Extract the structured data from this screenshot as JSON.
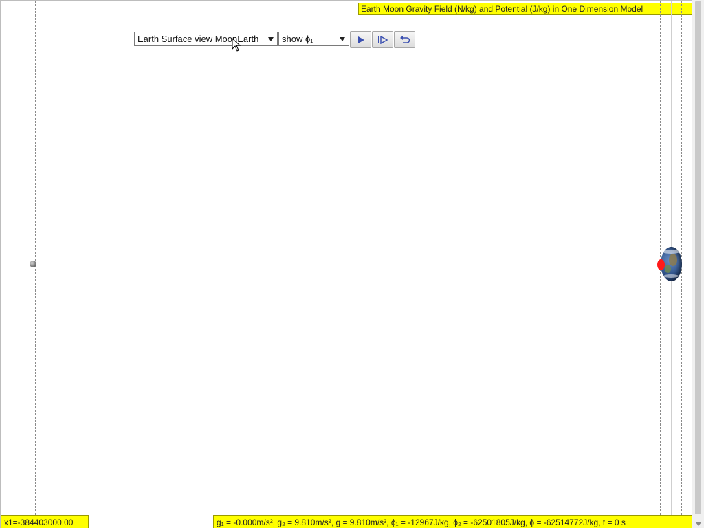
{
  "title": "Earth Moon Gravity Field (N/kg) and Potential (J/kg) in One Dimension Model",
  "controls": {
    "view_select": {
      "selected": "Earth Surface view MoonEarth"
    },
    "show_select": {
      "selected": "show ϕ₁"
    },
    "play_button_icon": "play-icon",
    "step_button_icon": "step-forward-icon",
    "reset_button_icon": "reset-icon"
  },
  "simulation": {
    "moon_label": "Moon",
    "earth_label": "Earth",
    "probe_color": "#ff1a1a"
  },
  "status": {
    "position_readout": "x1=-384403000.00",
    "values_readout": "g₁ = -0.000m/s², g₂ = 9.810m/s², g = 9.810m/s², ϕ₁ = -12967J/kg, ϕ₂ = -62501805J/kg, ϕ = -62514772J/kg, t = 0 s"
  },
  "colors": {
    "accent": "#ffff00",
    "probe": "#ff1a1a"
  }
}
